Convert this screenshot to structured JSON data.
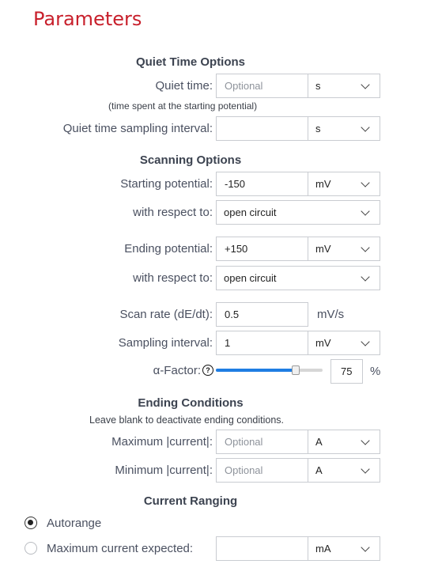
{
  "title": "Parameters",
  "quiet": {
    "heading": "Quiet Time Options",
    "time_label": "Quiet time:",
    "time_placeholder": "Optional",
    "time_unit": "s",
    "note": "(time spent at the starting potential)",
    "interval_label": "Quiet time sampling interval:",
    "interval_value": "",
    "interval_unit": "s"
  },
  "scan": {
    "heading": "Scanning Options",
    "start_label": "Starting potential:",
    "start_value": "-150",
    "start_unit": "mV",
    "start_ref_label": "with respect to:",
    "start_ref": "open circuit",
    "end_label": "Ending potential:",
    "end_value": "+150",
    "end_unit": "mV",
    "end_ref_label": "with respect to:",
    "end_ref": "open circuit",
    "rate_label": "Scan rate (dE/dt):",
    "rate_value": "0.5",
    "rate_unit": "mV/s",
    "sampling_label": "Sampling interval:",
    "sampling_value": "1",
    "sampling_unit": "mV",
    "alpha_label": "α-Factor:",
    "alpha_help": "?",
    "alpha_value": "75",
    "alpha_fraction": 0.75,
    "alpha_unit": "%"
  },
  "ending": {
    "heading": "Ending Conditions",
    "note": "Leave blank to deactivate ending conditions.",
    "max_label": "Maximum |current|:",
    "max_placeholder": "Optional",
    "max_unit": "A",
    "min_label": "Minimum |current|:",
    "min_placeholder": "Optional",
    "min_unit": "A"
  },
  "ranging": {
    "heading": "Current Ranging",
    "autorange_label": "Autorange",
    "autorange_selected": true,
    "max_expected_label": "Maximum current expected:",
    "max_expected_value": "",
    "max_expected_unit": "mA"
  },
  "colors": {
    "title": "#c8202c",
    "slider": "#1f7de3"
  }
}
